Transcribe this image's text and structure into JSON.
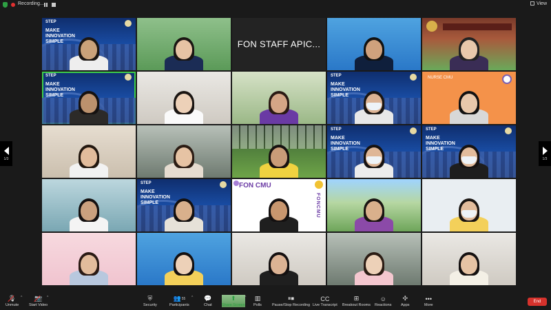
{
  "topbar": {
    "recording_label": "Recording...",
    "view_label": "View"
  },
  "nav": {
    "left_page": "1/3",
    "right_page": "1/3"
  },
  "banner": {
    "logo_text": "STEP",
    "slogan_lines": [
      "MAKE",
      "INNOVATION",
      "SIMPLE"
    ]
  },
  "tiles": [
    {
      "id": "t1",
      "kind": "banner",
      "person": {
        "skin": "#caa27a",
        "hair": "#1a1512",
        "shirt": "#eeeeee"
      }
    },
    {
      "id": "t2",
      "kind": "green",
      "person": {
        "skin": "#e6c3a4",
        "hair": "#1a1512",
        "shirt": "#1b2c55"
      }
    },
    {
      "id": "t3",
      "kind": "name",
      "name": "FON STAFF APIC..."
    },
    {
      "id": "t4",
      "kind": "blue",
      "person": {
        "skin": "#cfa17d",
        "hair": "#111",
        "shirt": "#0f1f3c"
      }
    },
    {
      "id": "t5",
      "kind": "uni",
      "person": {
        "skin": "#e8c8ab",
        "hair": "#222",
        "shirt": "#3a2d55"
      }
    },
    {
      "id": "t6",
      "kind": "banner",
      "active": true,
      "person": {
        "skin": "#bb916d",
        "hair": "#151110",
        "shirt": "#2c2a28"
      }
    },
    {
      "id": "t7",
      "kind": "office",
      "person": {
        "skin": "#edd1b8",
        "hair": "#1a1512",
        "shirt": "#fafafa"
      }
    },
    {
      "id": "t8",
      "kind": "green2",
      "person": {
        "skin": "#d4a586",
        "hair": "#2a1a14",
        "shirt": "#6a3aa4"
      }
    },
    {
      "id": "t9",
      "kind": "banner",
      "person": {
        "skin": "#dcb394",
        "hair": "#1a1512",
        "shirt": "#e8e8e8",
        "mask": true
      }
    },
    {
      "id": "t10",
      "kind": "orange",
      "label": "NURSE CMU",
      "person": {
        "skin": "#e8c8ab",
        "hair": "#111",
        "shirt": "#d8d8d8"
      }
    },
    {
      "id": "t11",
      "kind": "room",
      "person": {
        "skin": "#e2bc9c",
        "hair": "#22170f",
        "shirt": "#f2f2f2"
      }
    },
    {
      "id": "t12",
      "kind": "lobby",
      "person": {
        "skin": "#e6c3a4",
        "hair": "#2b1c14",
        "shirt": "#e6dcd0"
      }
    },
    {
      "id": "t13",
      "kind": "grass",
      "person": {
        "skin": "#c99c78",
        "hair": "#171210",
        "shirt": "#f0d240"
      }
    },
    {
      "id": "t14",
      "kind": "banner",
      "person": {
        "skin": "#dfb797",
        "hair": "#161211",
        "shirt": "#ececec",
        "mask": true
      }
    },
    {
      "id": "t15",
      "kind": "banner",
      "person": {
        "skin": "#e2bc9c",
        "hair": "#161211",
        "shirt": "#1e1e1e",
        "mask": true
      }
    },
    {
      "id": "t16",
      "kind": "teal",
      "person": {
        "skin": "#caa07e",
        "hair": "#141010",
        "shirt": "#f4f4f4"
      }
    },
    {
      "id": "t17",
      "kind": "banner",
      "person": {
        "skin": "#d9b08c",
        "hair": "#141010",
        "shirt": "#e6e1d8"
      }
    },
    {
      "id": "t18",
      "kind": "fon",
      "title": "FON CMU",
      "vertical": "FONCMU",
      "person": {
        "skin": "#c8966e",
        "hair": "#141010",
        "shirt": "#1f1f1f"
      }
    },
    {
      "id": "t19",
      "kind": "park",
      "person": {
        "skin": "#d9b08c",
        "hair": "#1a1512",
        "shirt": "#8b4aa8"
      }
    },
    {
      "id": "t20",
      "kind": "bgscreen",
      "person": {
        "skin": "#e2bc9c",
        "hair": "#1a1512",
        "shirt": "#f3d05a",
        "mask": true
      }
    },
    {
      "id": "t21",
      "kind": "pink",
      "person": {
        "skin": "#e2bc9c",
        "hair": "#2a1a14",
        "shirt": "#b8c8de"
      }
    },
    {
      "id": "t22",
      "kind": "blue",
      "person": {
        "skin": "#edd1b8",
        "hair": "#141010",
        "shirt": "#f3d05a"
      }
    },
    {
      "id": "t23",
      "kind": "office",
      "person": {
        "skin": "#dcb394",
        "hair": "#141010",
        "shirt": "#1f1f1f"
      }
    },
    {
      "id": "t24",
      "kind": "lobby",
      "person": {
        "skin": "#edd1b8",
        "hair": "#2b1c14",
        "shirt": "#f4c7cf"
      }
    },
    {
      "id": "t25",
      "kind": "office",
      "person": {
        "skin": "#e6c3a4",
        "hair": "#141010",
        "shirt": "#f4f0e6"
      }
    }
  ],
  "toolbar": {
    "unmute": "Unmute",
    "start_video": "Start Video",
    "security": "Security",
    "participants": "Participants",
    "participants_count": "55",
    "chat": "Chat",
    "share_screen": "Share Screen",
    "polls": "Polls",
    "recording": "Pause/Stop Recording",
    "transcript": "Live Transcript",
    "breakout": "Breakout Rooms",
    "reactions": "Reactions",
    "apps": "Apps",
    "more": "More",
    "end": "End"
  },
  "colors": {
    "accent_green": "#2ea043",
    "end_red": "#d6322c",
    "active_speaker": "#3ecf4a"
  }
}
